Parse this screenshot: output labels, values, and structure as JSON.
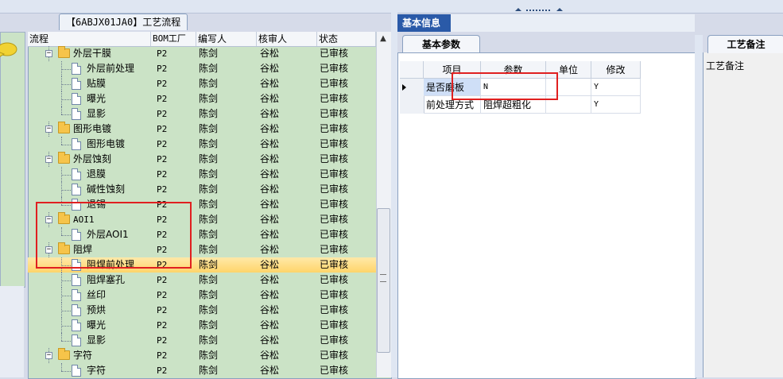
{
  "tree_tab_title": "【6ABJX01JA0】工艺流程",
  "tree_columns": [
    "流程",
    "BOM工厂",
    "编写人",
    "核审人",
    "状态"
  ],
  "tree_rows": [
    {
      "label": "外层干膜",
      "kind": "folder",
      "bom": "P2",
      "writer": "陈剑",
      "reviewer": "谷松",
      "status": "已审核"
    },
    {
      "label": "外层前处理",
      "kind": "doc",
      "bom": "P2",
      "writer": "陈剑",
      "reviewer": "谷松",
      "status": "已审核"
    },
    {
      "label": "贴膜",
      "kind": "doc",
      "bom": "P2",
      "writer": "陈剑",
      "reviewer": "谷松",
      "status": "已审核"
    },
    {
      "label": "曝光",
      "kind": "doc",
      "bom": "P2",
      "writer": "陈剑",
      "reviewer": "谷松",
      "status": "已审核"
    },
    {
      "label": "显影",
      "kind": "doc",
      "bom": "P2",
      "writer": "陈剑",
      "reviewer": "谷松",
      "status": "已审核"
    },
    {
      "label": "图形电镀",
      "kind": "folder",
      "bom": "P2",
      "writer": "陈剑",
      "reviewer": "谷松",
      "status": "已审核"
    },
    {
      "label": "图形电镀",
      "kind": "doc",
      "bom": "P2",
      "writer": "陈剑",
      "reviewer": "谷松",
      "status": "已审核"
    },
    {
      "label": "外层蚀刻",
      "kind": "folder",
      "bom": "P2",
      "writer": "陈剑",
      "reviewer": "谷松",
      "status": "已审核"
    },
    {
      "label": "退膜",
      "kind": "doc",
      "bom": "P2",
      "writer": "陈剑",
      "reviewer": "谷松",
      "status": "已审核"
    },
    {
      "label": "碱性蚀刻",
      "kind": "doc",
      "bom": "P2",
      "writer": "陈剑",
      "reviewer": "谷松",
      "status": "已审核"
    },
    {
      "label": "退锡",
      "kind": "doc",
      "bom": "P2",
      "writer": "陈剑",
      "reviewer": "谷松",
      "status": "已审核"
    },
    {
      "label": "AOI1",
      "kind": "folder",
      "bom": "P2",
      "writer": "陈剑",
      "reviewer": "谷松",
      "status": "已审核"
    },
    {
      "label": "外层AOI1",
      "kind": "doc",
      "bom": "P2",
      "writer": "陈剑",
      "reviewer": "谷松",
      "status": "已审核"
    },
    {
      "label": "阻焊",
      "kind": "folder",
      "bom": "P2",
      "writer": "陈剑",
      "reviewer": "谷松",
      "status": "已审核"
    },
    {
      "label": "阻焊前处理",
      "kind": "doc",
      "bom": "P2",
      "writer": "陈剑",
      "reviewer": "谷松",
      "status": "已审核",
      "selected": true
    },
    {
      "label": "阻焊塞孔",
      "kind": "doc",
      "bom": "P2",
      "writer": "陈剑",
      "reviewer": "谷松",
      "status": "已审核"
    },
    {
      "label": "丝印",
      "kind": "doc",
      "bom": "P2",
      "writer": "陈剑",
      "reviewer": "谷松",
      "status": "已审核"
    },
    {
      "label": "预烘",
      "kind": "doc",
      "bom": "P2",
      "writer": "陈剑",
      "reviewer": "谷松",
      "status": "已审核"
    },
    {
      "label": "曝光",
      "kind": "doc",
      "bom": "P2",
      "writer": "陈剑",
      "reviewer": "谷松",
      "status": "已审核"
    },
    {
      "label": "显影",
      "kind": "doc",
      "bom": "P2",
      "writer": "陈剑",
      "reviewer": "谷松",
      "status": "已审核"
    },
    {
      "label": "字符",
      "kind": "folder",
      "bom": "P2",
      "writer": "陈剑",
      "reviewer": "谷松",
      "status": "已审核"
    },
    {
      "label": "字符",
      "kind": "doc",
      "bom": "P2",
      "writer": "陈剑",
      "reviewer": "谷松",
      "status": "已审核"
    }
  ],
  "basic_info_tab": "基本信息",
  "basic_params_tab": "基本参数",
  "param_columns": [
    "项目",
    "参数",
    "单位",
    "修改"
  ],
  "param_rows": [
    {
      "item": "是否磨板",
      "param": "N",
      "unit": "",
      "modify": "Y"
    },
    {
      "item": "前处理方式",
      "param": "阻焊超粗化",
      "unit": "",
      "modify": "Y"
    }
  ],
  "remarks_tab": "工艺备注",
  "remarks_label": "工艺备注",
  "icons": {
    "row_indicator": "row-pointer-icon",
    "scroll_up": "scroll-up-arrow-icon",
    "speech": "speech-bubble-icon"
  },
  "colors": {
    "tree_bg": "#cbe3c6",
    "selected_row": "#ffd46a",
    "tab_active": "#2a5aa8",
    "annotation_red": "#e02020"
  }
}
